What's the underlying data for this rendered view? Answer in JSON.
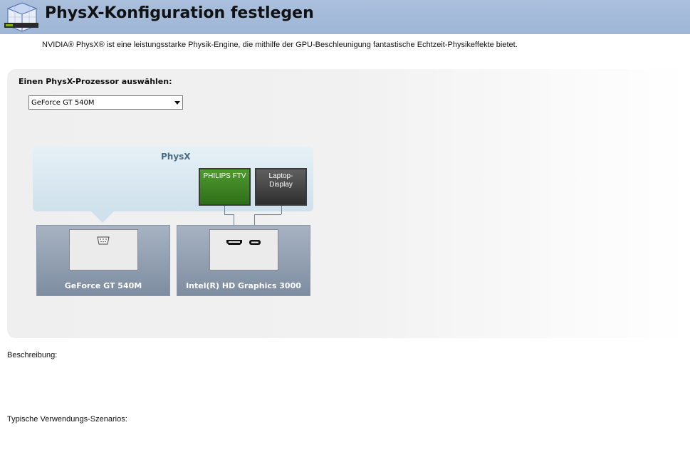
{
  "header": {
    "title": "PhysX-Konfiguration festlegen",
    "icon": "physx-cube-icon"
  },
  "intro": "NVIDIA® PhysX® ist eine leistungsstarke Physik-Engine, die mithilfe der GPU-Beschleunigung fantastische Echtzeit-Physikeffekte bietet.",
  "processor": {
    "label": "Einen PhysX-Prozessor auswählen:",
    "selected": "GeForce GT 540M"
  },
  "diagram": {
    "physx_label": "PhysX",
    "monitors": [
      {
        "label": "PHILIPS FTV",
        "color": "#3f8a26"
      },
      {
        "label": "Laptop-Display",
        "line1": "Laptop-",
        "line2": "Display",
        "color": "#3a3a3a"
      }
    ],
    "gpus": [
      {
        "label": "GeForce GT 540M",
        "port_icon": "vga-port-icon"
      },
      {
        "label": "Intel(R) HD Graphics 3000",
        "port_icons": [
          "hdmi-port-icon",
          "displayport-icon"
        ]
      }
    ]
  },
  "description_label": "Beschreibung:",
  "usage_label": "Typische Verwendungs-Szenarios:"
}
